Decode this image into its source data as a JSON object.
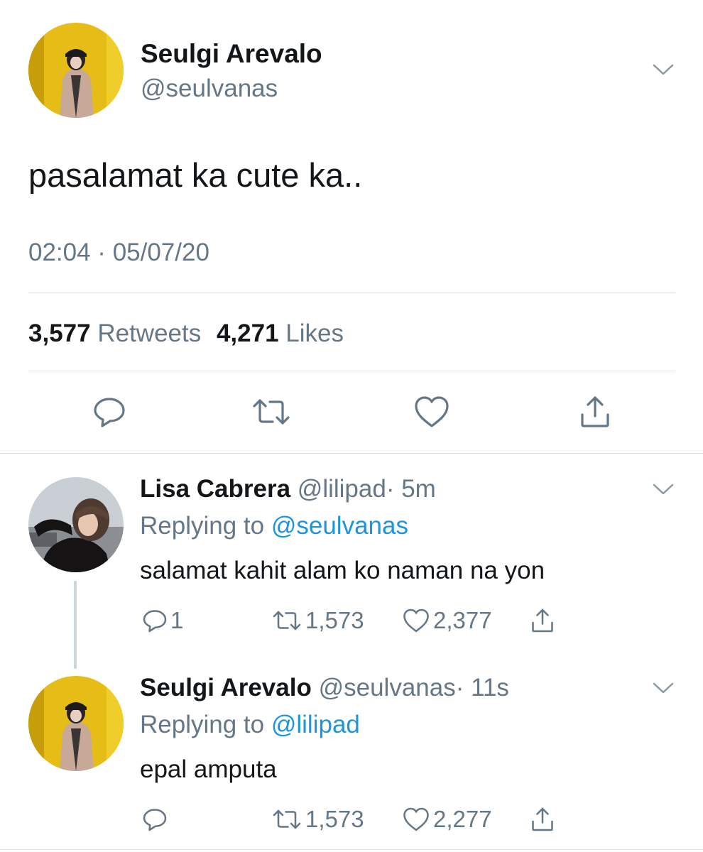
{
  "main_tweet": {
    "name": "Seulgi Arevalo",
    "handle": "@seulvanas",
    "text": "pasalamat ka cute ka..",
    "timestamp": "02:04 · 05/07/20",
    "retweet_count": "3,577",
    "retweet_label": "Retweets",
    "like_count": "4,271",
    "like_label": "Likes",
    "avatar_color": "#e3b814",
    "actions": [
      "reply-icon",
      "retweet-icon",
      "like-icon",
      "share-icon"
    ]
  },
  "replies": [
    {
      "name": "Lisa Cabrera",
      "handle": "@lilipad",
      "age": "· 5m",
      "replying_prefix": "Replying to",
      "replying_to": "@seulvanas",
      "text": "salamat kahit alam ko naman na yon",
      "reply_count": "1",
      "retweet_count": "1,573",
      "like_count": "2,377"
    },
    {
      "name": "Seulgi Arevalo",
      "handle": "@seulvanas",
      "age": "· 11s",
      "replying_prefix": "Replying to",
      "replying_to": "@lilipad",
      "text": "epal amputa",
      "reply_count": "",
      "retweet_count": "1,573",
      "like_count": "2,277"
    }
  ],
  "colors": {
    "text": "#14171a",
    "secondary": "#657786",
    "link": "#1b95e0",
    "divider": "#e1e8ed"
  }
}
